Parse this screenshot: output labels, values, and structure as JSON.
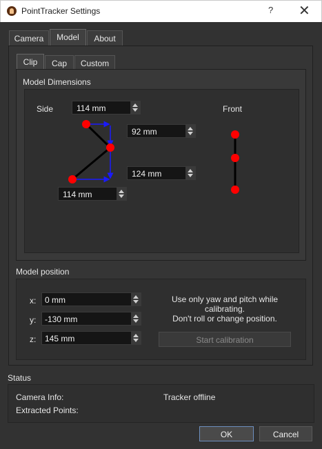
{
  "window": {
    "title": "PointTracker Settings",
    "help": "?",
    "close": "✕"
  },
  "tabs": {
    "camera": "Camera",
    "model": "Model",
    "about": "About"
  },
  "subtabs": {
    "clip": "Clip",
    "cap": "Cap",
    "custom": "Custom"
  },
  "model_dimensions": {
    "group_title": "Model Dimensions",
    "side_label": "Side",
    "front_label": "Front",
    "side_top": "114 mm",
    "upper_right": "92 mm",
    "lower_right": "124 mm",
    "bottom": "114 mm"
  },
  "model_position": {
    "group_title": "Model position",
    "x_label": "x:",
    "x_value": "0 mm",
    "y_label": "y:",
    "y_value": "-130 mm",
    "z_label": "z:",
    "z_value": "145 mm",
    "hint_line1": "Use only yaw and pitch while calibrating.",
    "hint_line2": "Don't roll or change position.",
    "calibrate_button": "Start calibration"
  },
  "status": {
    "title": "Status",
    "camera_info_label": "Camera Info:",
    "camera_info_value": "Tracker offline",
    "extracted_points_label": "Extracted Points:",
    "extracted_points_value": ""
  },
  "buttons": {
    "ok": "OK",
    "cancel": "Cancel"
  },
  "colors": {
    "point": "#ff0000",
    "arrow": "#1a1aff",
    "line": "#000000"
  }
}
